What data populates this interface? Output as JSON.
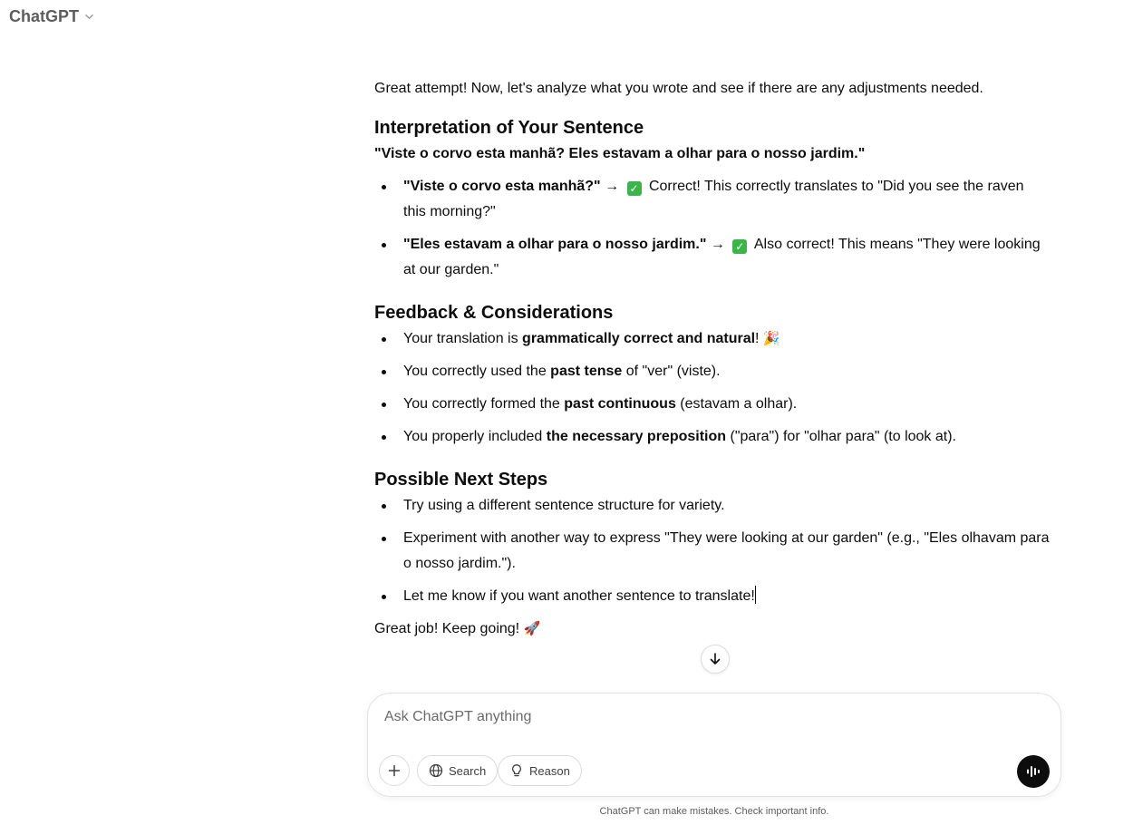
{
  "header": {
    "model_name": "ChatGPT"
  },
  "message": {
    "intro": "Great attempt! Now, let's analyze what you wrote and see if there are any adjustments needed.",
    "interpretation": {
      "heading": "Interpretation of Your Sentence",
      "quote": "\"Viste o corvo esta manhã? Eles estavam a olhar para o nosso jardim.\"",
      "items": [
        {
          "bold": "\"Viste o corvo esta manhã?\"",
          "arrow": " → ",
          "check": "✓",
          "rest": " Correct! This correctly translates to \"Did you see the raven this morning?\""
        },
        {
          "bold": "\"Eles estavam a olhar para o nosso jardim.\"",
          "arrow": " → ",
          "check": "✓",
          "rest": " Also correct! This means \"They were looking at our garden.\""
        }
      ]
    },
    "feedback": {
      "heading": "Feedback & Considerations",
      "items": [
        {
          "pre": "Your translation is ",
          "bold": "grammatically correct and natural",
          "post": "! ",
          "emoji": "🎉"
        },
        {
          "pre": "You correctly used the ",
          "bold": "past tense",
          "post": " of \"ver\" (viste)."
        },
        {
          "pre": "You correctly formed the ",
          "bold": "past continuous",
          "post": " (estavam a olhar)."
        },
        {
          "pre": "You properly included ",
          "bold": "the necessary preposition",
          "post": " (\"para\") for \"olhar para\" (to look at)."
        }
      ]
    },
    "next_steps": {
      "heading": "Possible Next Steps",
      "items": [
        "Try using a different sentence structure for variety.",
        "Experiment with another way to express \"They were looking at our garden\" (e.g., \"Eles olhavam para o nosso jardim.\").",
        "Let me know if you want another sentence to translate!"
      ]
    },
    "closing": "Great job! Keep going! ",
    "closing_emoji": "🚀"
  },
  "composer": {
    "placeholder": "Ask ChatGPT anything",
    "search_label": "Search",
    "reason_label": "Reason"
  },
  "footer": {
    "disclaimer": "ChatGPT can make mistakes. Check important info."
  },
  "colors": {
    "check_green": "#3ab54a",
    "voice_button": "#0d0d0d"
  },
  "icons": [
    "chevron-down-icon",
    "check-icon",
    "party-popper-icon",
    "rocket-icon",
    "arrow-down-icon",
    "plus-icon",
    "globe-icon",
    "lightbulb-icon",
    "voice-icon"
  ]
}
